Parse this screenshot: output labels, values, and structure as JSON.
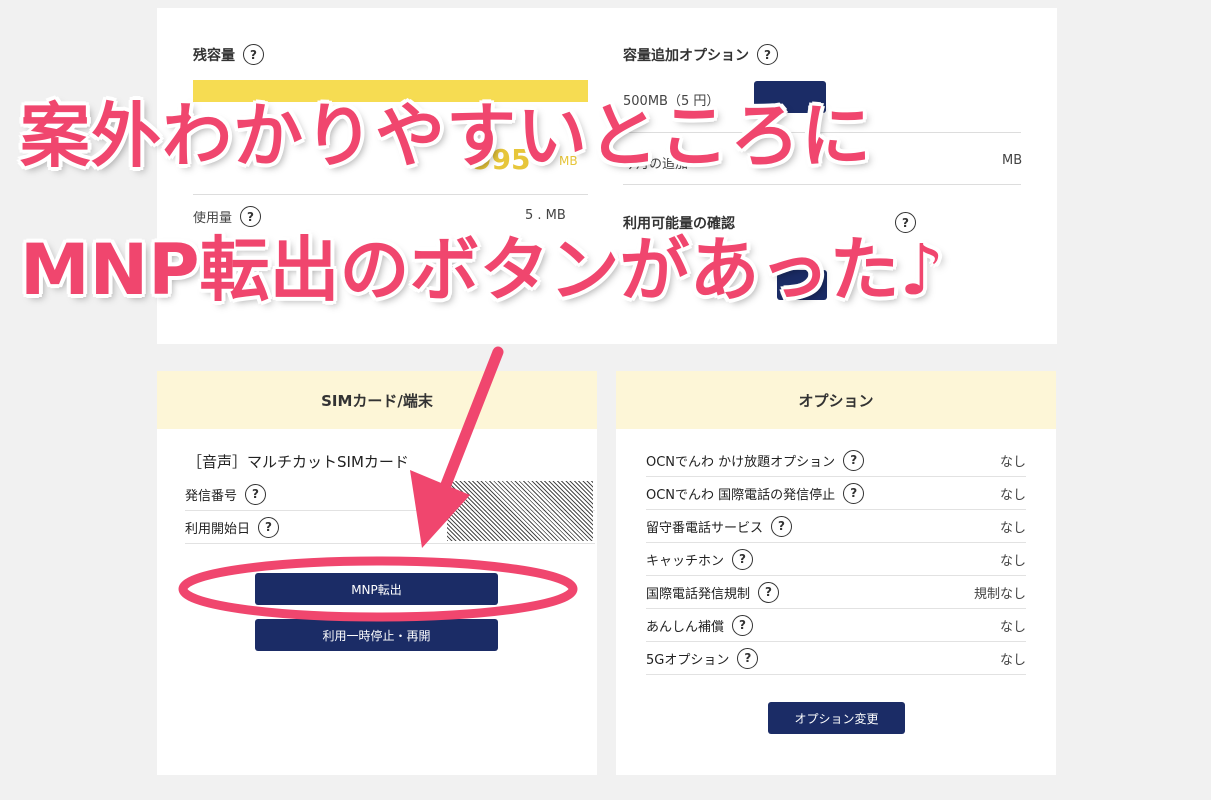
{
  "overlay": {
    "line1": "案外わかりやすいところに",
    "line2": "MNP転出のボタンがあった♪",
    "accent_color": "#f0466e"
  },
  "top_card": {
    "remaining_title": "残容量",
    "remaining_value": "995",
    "remaining_unit": "MB",
    "used_label": "使用量",
    "used_value": "5 .   MB",
    "addon_title": "容量追加オプション",
    "addon_item": "500MB（5   円）",
    "addon_month_label": "今月の追加",
    "addon_month_unit": "MB",
    "usage_switch_title": "利用可能量の確認"
  },
  "sim_card": {
    "header": "SIMカード/端末",
    "sim_name": "［音声］マルチカットSIMカード",
    "rows": [
      {
        "label": "発信番号"
      },
      {
        "label": "利用開始日"
      }
    ],
    "mnp_button": "MNP転出",
    "pause_button": "利用一時停止・再開"
  },
  "option_card": {
    "header": "オプション",
    "rows": [
      {
        "label": "OCNでんわ かけ放題オプション",
        "value": "なし"
      },
      {
        "label": "OCNでんわ 国際電話の発信停止",
        "value": "なし"
      },
      {
        "label": "留守番電話サービス",
        "value": "なし"
      },
      {
        "label": "キャッチホン",
        "value": "なし"
      },
      {
        "label": "国際電話発信規制",
        "value": "規制なし"
      },
      {
        "label": "あんしん補償",
        "value": "なし"
      },
      {
        "label": "5Gオプション",
        "value": "なし"
      }
    ],
    "change_button": "オプション変更"
  },
  "icons": {
    "help": "question-circle-icon",
    "help_glyph": "?"
  },
  "colors": {
    "navy": "#1b2c66",
    "header_bg": "#fdf6d7",
    "yellow": "#f6dc52"
  }
}
